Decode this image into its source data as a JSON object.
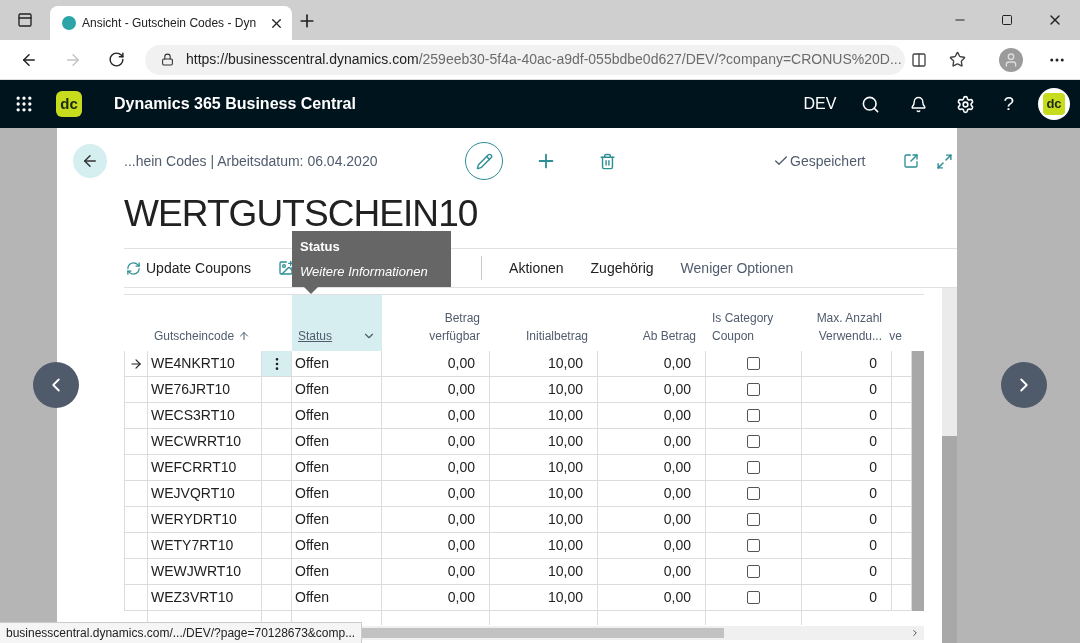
{
  "browser": {
    "tab_title": "Ansicht - Gutschein Codes - Dyn",
    "url_host": "https://businesscentral.dynamics.com",
    "url_path": "/259eeb30-5f4a-40ac-a9df-055bdbe0d627/DEV/?company=CRONUS%20D...",
    "status_url": "businesscentral.dynamics.com/.../DEV/?page=70128673&comp..."
  },
  "app_bar": {
    "logo_text": "dc",
    "title": "Dynamics 365 Business Central",
    "environment": "DEV",
    "help_glyph": "?",
    "avatar_text": "dc"
  },
  "page": {
    "breadcrumb": "...hein Codes | Arbeitsdatum: 06.04.2020",
    "saved": "Gespeichert",
    "title": "WERTGUTSCHEIN10"
  },
  "actions": [
    {
      "kind": "icon-text",
      "label": "Update Coupons"
    },
    {
      "kind": "icon-only"
    },
    {
      "kind": "separator"
    },
    {
      "kind": "text",
      "label": "Aktionen"
    },
    {
      "kind": "text",
      "label": "Zugehörig"
    },
    {
      "kind": "muted",
      "label": "Weniger Optionen"
    }
  ],
  "tooltip": {
    "title": "Status",
    "text": "Weitere Informationen"
  },
  "table": {
    "columns": [
      {
        "label": "Gutscheincode",
        "sorted": true,
        "selected": false
      },
      {
        "label": "Status",
        "sorted": false,
        "selected": true
      },
      {
        "label": "Betrag verfügbar",
        "sorted": false,
        "selected": false
      },
      {
        "label": "Initialbetrag",
        "sorted": false,
        "selected": false
      },
      {
        "label": "Ab Betrag",
        "sorted": false,
        "selected": false
      },
      {
        "label": "Is Category Coupon",
        "sorted": false,
        "selected": false
      },
      {
        "label": "Max. Anzahl Verwendu...",
        "sorted": false,
        "selected": false
      },
      {
        "label": "ve",
        "sorted": false,
        "selected": false
      }
    ],
    "rows": [
      {
        "code": "WE4NKRT10",
        "status": "Offen",
        "available": "0,00",
        "initial": "10,00",
        "from": "0,00",
        "is_category": false,
        "max_uses": "0",
        "selected": true
      },
      {
        "code": "WE76JRT10",
        "status": "Offen",
        "available": "0,00",
        "initial": "10,00",
        "from": "0,00",
        "is_category": false,
        "max_uses": "0",
        "selected": false
      },
      {
        "code": "WECS3RT10",
        "status": "Offen",
        "available": "0,00",
        "initial": "10,00",
        "from": "0,00",
        "is_category": false,
        "max_uses": "0",
        "selected": false
      },
      {
        "code": "WECWRRT10",
        "status": "Offen",
        "available": "0,00",
        "initial": "10,00",
        "from": "0,00",
        "is_category": false,
        "max_uses": "0",
        "selected": false
      },
      {
        "code": "WEFCRRT10",
        "status": "Offen",
        "available": "0,00",
        "initial": "10,00",
        "from": "0,00",
        "is_category": false,
        "max_uses": "0",
        "selected": false
      },
      {
        "code": "WEJVQRT10",
        "status": "Offen",
        "available": "0,00",
        "initial": "10,00",
        "from": "0,00",
        "is_category": false,
        "max_uses": "0",
        "selected": false
      },
      {
        "code": "WERYDRT10",
        "status": "Offen",
        "available": "0,00",
        "initial": "10,00",
        "from": "0,00",
        "is_category": false,
        "max_uses": "0",
        "selected": false
      },
      {
        "code": "WETY7RT10",
        "status": "Offen",
        "available": "0,00",
        "initial": "10,00",
        "from": "0,00",
        "is_category": false,
        "max_uses": "0",
        "selected": false
      },
      {
        "code": "WEWJWRT10",
        "status": "Offen",
        "available": "0,00",
        "initial": "10,00",
        "from": "0,00",
        "is_category": false,
        "max_uses": "0",
        "selected": false
      },
      {
        "code": "WEZ3VRT10",
        "status": "Offen",
        "available": "0,00",
        "initial": "10,00",
        "from": "0,00",
        "is_category": false,
        "max_uses": "0",
        "selected": false
      }
    ]
  }
}
